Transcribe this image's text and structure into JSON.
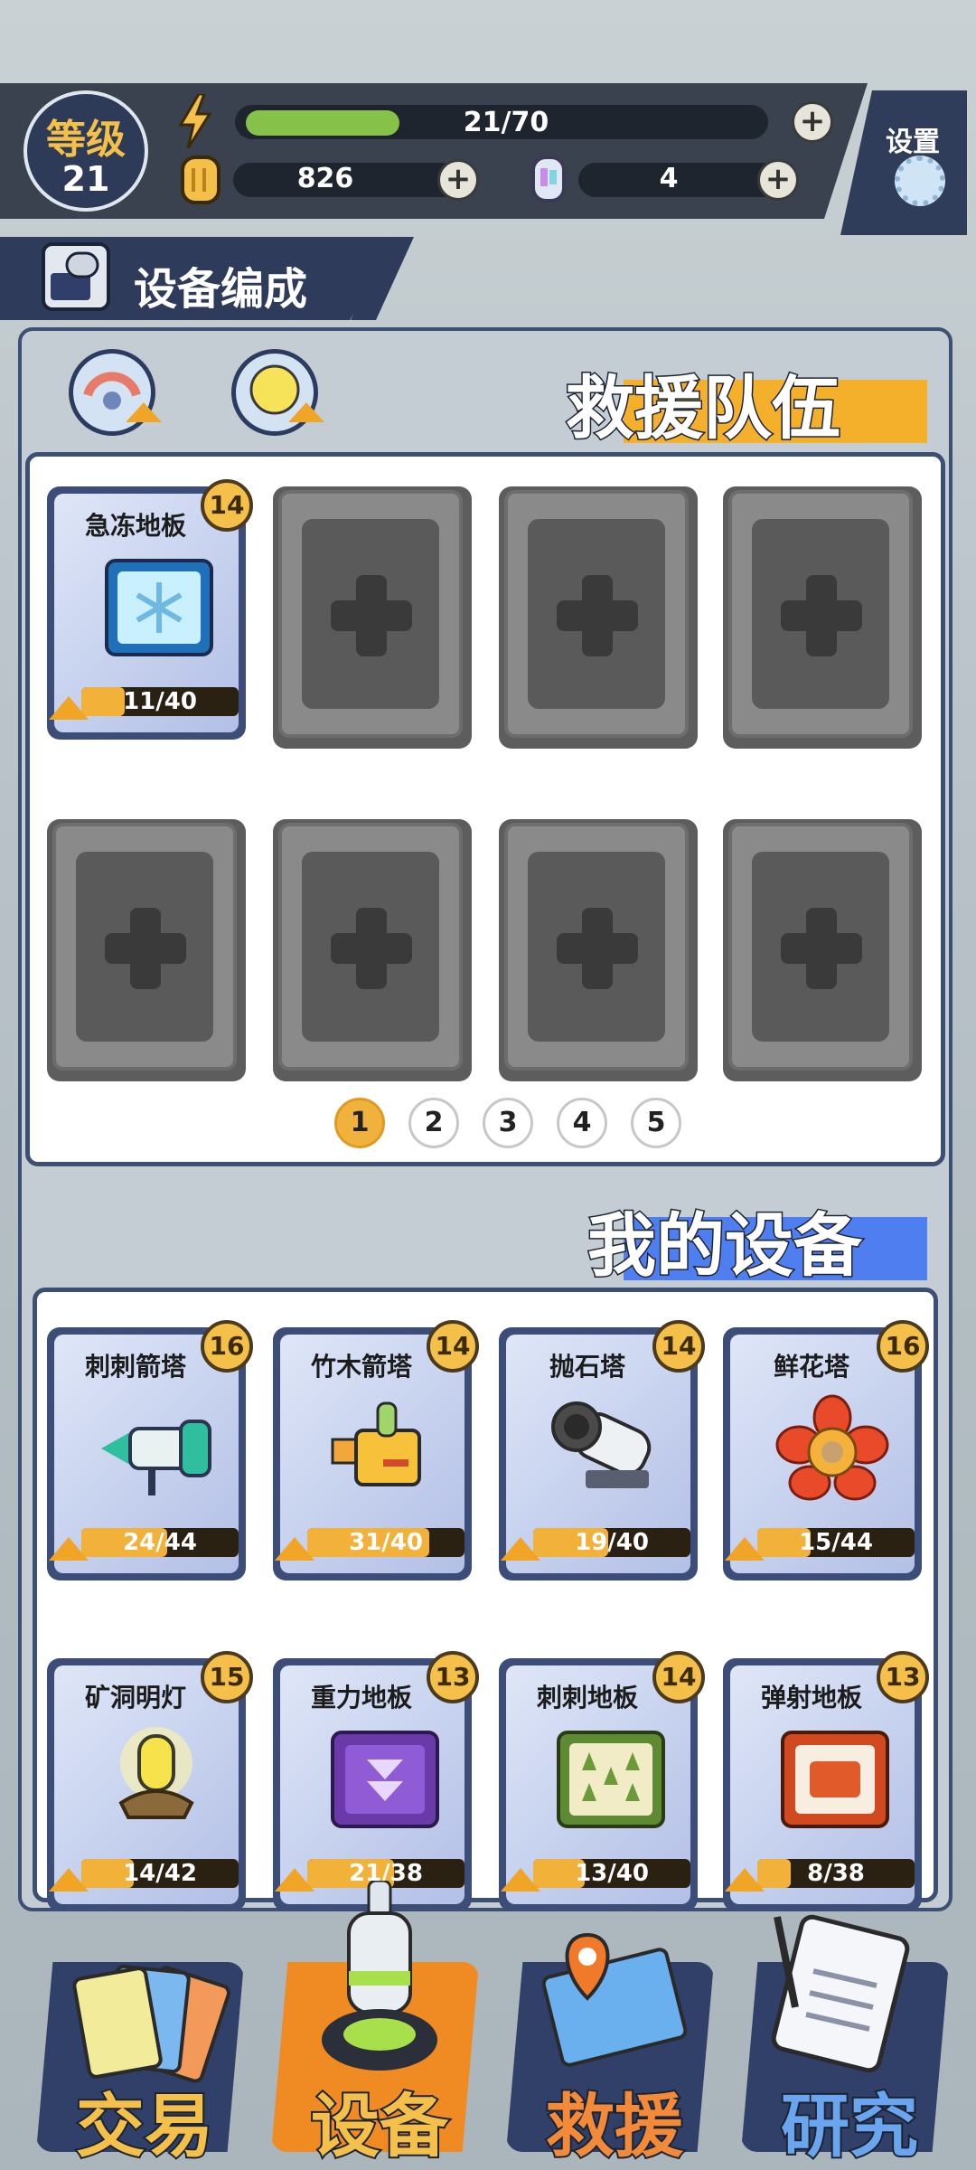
{
  "status_bar": {
    "level_label": "等级",
    "level_value": "21",
    "energy_text": "21/70",
    "energy_fraction": 0.3,
    "coins": "826",
    "gems": "4",
    "settings_label": "设置"
  },
  "section": {
    "title": "设备编成"
  },
  "team": {
    "heading": "救援队伍",
    "equipped": [
      {
        "name": "急冻地板",
        "level": "14",
        "progress": "11/40",
        "fraction": 0.275,
        "icon": "snowflake-tile-icon"
      }
    ],
    "empty_slot_count_text": "",
    "pages": [
      "1",
      "2",
      "3",
      "4",
      "5"
    ],
    "selected_page": "1"
  },
  "my_equipment": {
    "heading": "我的设备",
    "items": [
      {
        "name": "刺刺箭塔",
        "level": "16",
        "progress": "24/44",
        "fraction": 0.545,
        "icon": "spike-arrow-tower-icon"
      },
      {
        "name": "竹木箭塔",
        "level": "14",
        "progress": "31/40",
        "fraction": 0.775,
        "icon": "bamboo-tower-icon"
      },
      {
        "name": "抛石塔",
        "level": "14",
        "progress": "19/40",
        "fraction": 0.475,
        "icon": "catapult-tower-icon"
      },
      {
        "name": "鲜花塔",
        "level": "16",
        "progress": "15/44",
        "fraction": 0.34,
        "icon": "flower-tower-icon"
      },
      {
        "name": "矿洞明灯",
        "level": "15",
        "progress": "14/42",
        "fraction": 0.333,
        "icon": "mine-lamp-icon"
      },
      {
        "name": "重力地板",
        "level": "13",
        "progress": "21/38",
        "fraction": 0.553,
        "icon": "gravity-tile-icon"
      },
      {
        "name": "刺刺地板",
        "level": "14",
        "progress": "13/40",
        "fraction": 0.325,
        "icon": "spike-tile-icon"
      },
      {
        "name": "弹射地板",
        "level": "13",
        "progress": "8/38",
        "fraction": 0.21,
        "icon": "launch-tile-icon"
      }
    ]
  },
  "bottom_nav": [
    {
      "label": "交易",
      "icon": "cards-icon",
      "active": false
    },
    {
      "label": "设备",
      "icon": "drill-tower-icon",
      "active": true
    },
    {
      "label": "救援",
      "icon": "map-pin-icon",
      "active": false
    },
    {
      "label": "研究",
      "icon": "clipboard-icon",
      "active": false
    }
  ],
  "colors": {
    "accent": "#f4c04a",
    "nav_active": "#f08a22",
    "panel_border": "#3d4f72"
  }
}
